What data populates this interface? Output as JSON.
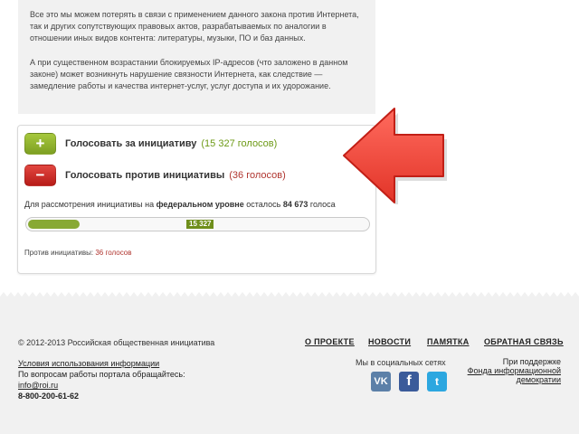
{
  "info": {
    "para1": "Все это мы можем потерять в связи с применением данного закона против Интернета, так и других сопутствующих правовых актов, разрабатываемых по аналогии в отношении иных видов контента: литературы, музыки, ПО и баз данных.",
    "para2": "А при существенном возрастании блокируемых IP-адресов (что заложено в данном законе) может возникнуть нарушение связности Интернета, как следствие — замедление работы и качества интернет-услуг, услуг доступа и их удорожание."
  },
  "vote": {
    "pro_icon": "+",
    "pro_label": "Голосовать за инициативу",
    "pro_count": "(15 327 голосов)",
    "contra_icon": "−",
    "contra_label": "Голосовать против инициативы",
    "contra_count": "(36 голосов)",
    "fed_prefix": "Для рассмотрения инициативы на",
    "fed_level": "федеральном уровне",
    "fed_middle": "осталось",
    "fed_remaining": "84 673",
    "fed_suffix": "голоса",
    "progress_value": "15 327",
    "progress_fraction": 0.153,
    "contra_line_label": "Против инициативы:",
    "contra_line_value": "36 голосов"
  },
  "footer": {
    "copyright": "© 2012-2013 Российская общественная инициатива",
    "nav": [
      "О ПРОЕКТЕ",
      "НОВОСТИ",
      "ПАМЯТКА",
      "ОБРАТНАЯ СВЯЗЬ"
    ],
    "terms_link": "Условия использования информации",
    "questions": "По вопросам работы портала обращайтесь:",
    "email": "info@roi.ru",
    "phone": "8-800-200-61-62",
    "social_title": "Мы в социальных сетях",
    "social_vk": "VK",
    "social_fb": "f",
    "social_tw": "t",
    "support_line1": "При поддержке",
    "support_line2": "Фонда информационной",
    "support_line3": "демократии"
  },
  "colors": {
    "accent_green": "#88a934",
    "accent_red": "#b0352f",
    "arrow_red": "#f2473d"
  },
  "icons": [
    "plus-icon",
    "minus-icon",
    "red-arrow-icon",
    "vk-icon",
    "facebook-icon",
    "twitter-icon"
  ]
}
